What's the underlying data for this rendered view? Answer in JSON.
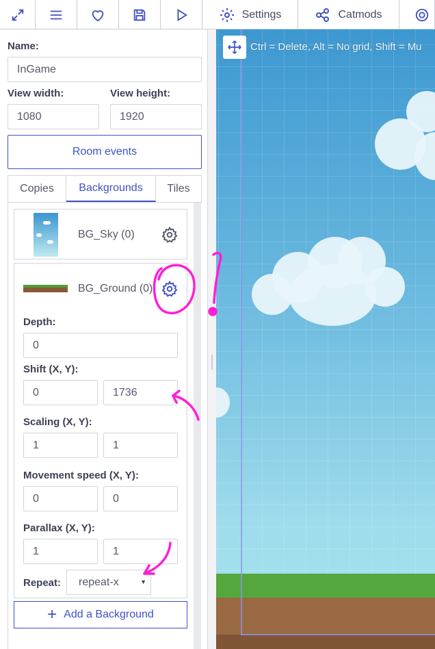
{
  "toolbar": {
    "settings_label": "Settings",
    "catmods_label": "Catmods"
  },
  "form": {
    "name_label": "Name:",
    "name_value": "InGame",
    "view_width_label": "View width:",
    "view_width_value": "1080",
    "view_height_label": "View height:",
    "view_height_value": "1920",
    "room_events_label": "Room events"
  },
  "tabs": [
    {
      "label": "Copies",
      "active": false
    },
    {
      "label": "Backgrounds",
      "active": true
    },
    {
      "label": "Tiles",
      "active": false
    }
  ],
  "backgrounds": [
    {
      "name": "BG_Sky (0)"
    },
    {
      "name": "BG_Ground (0)"
    }
  ],
  "bg_props": {
    "depth_label": "Depth:",
    "depth_value": "0",
    "shift_label": "Shift (X, Y):",
    "shift_x": "0",
    "shift_y": "1736",
    "scaling_label": "Scaling (X, Y):",
    "scaling_x": "1",
    "scaling_y": "1",
    "movement_label": "Movement speed (X, Y):",
    "movement_x": "0",
    "movement_y": "0",
    "parallax_label": "Parallax (X, Y):",
    "parallax_x": "1",
    "parallax_y": "1",
    "repeat_label": "Repeat:",
    "repeat_value": "repeat-x"
  },
  "add_background_label": "Add a Background",
  "canvas": {
    "hint": "Ctrl = Delete, Alt = No grid, Shift = Mu"
  },
  "colors": {
    "accent": "#3f51c4",
    "annotation": "#ff1fd6"
  }
}
